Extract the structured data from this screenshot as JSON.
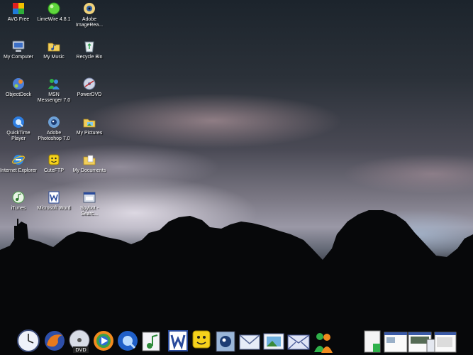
{
  "desktop": {
    "icons": [
      {
        "label": "AVG Free"
      },
      {
        "label": "LimeWire 4.8.1"
      },
      {
        "label": "Adobe ImageRea..."
      },
      {
        "label": "My Computer"
      },
      {
        "label": "My Music"
      },
      {
        "label": "Recycle Bin"
      },
      {
        "label": "ObjectDock"
      },
      {
        "label": "MSN Messenger 7.0"
      },
      {
        "label": "PowerDVD"
      },
      {
        "label": "QuickTime Player"
      },
      {
        "label": "Adobe Photoshop 7.0"
      },
      {
        "label": "My Pictures"
      },
      {
        "label": "Internet Explorer"
      },
      {
        "label": "CuteFTP"
      },
      {
        "label": "My Documents"
      },
      {
        "label": "iTunes"
      },
      {
        "label": "Microsoft Word"
      },
      {
        "label": "Spybot - Searc..."
      }
    ]
  },
  "dock": {
    "items": [
      {
        "icon": "clock-icon"
      },
      {
        "icon": "firefox-icon"
      },
      {
        "icon": "dvd-icon"
      },
      {
        "icon": "media-player-icon"
      },
      {
        "icon": "quicktime-icon"
      },
      {
        "icon": "itunes-icon"
      },
      {
        "icon": "word-icon"
      },
      {
        "icon": "cuteftp-icon"
      },
      {
        "icon": "photoshop-icon"
      },
      {
        "icon": "mail-icon"
      },
      {
        "icon": "photo-mail-icon"
      },
      {
        "icon": "envelope-icon"
      },
      {
        "icon": "msn-icon"
      },
      {
        "icon": "window-thumbnail-icon"
      },
      {
        "icon": "window-thumbnail-icon"
      },
      {
        "icon": "window-thumbnail-icon"
      },
      {
        "icon": "window-thumbnail-icon"
      },
      {
        "icon": "window-thumbnail-icon"
      }
    ]
  }
}
